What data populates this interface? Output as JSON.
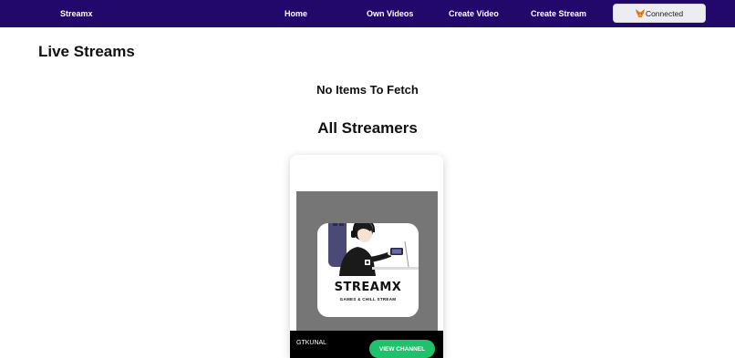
{
  "nav": {
    "brand": "Streamx",
    "links": [
      "Home",
      "Own Videos",
      "Create Video",
      "Create Stream"
    ],
    "wallet_label": "Connected",
    "wallet_icon": "metamask-fox-icon"
  },
  "live": {
    "title": "Live Streams",
    "empty_message": "No Items To Fetch"
  },
  "streamers": {
    "title": "All Streamers",
    "cards": [
      {
        "image_title": "STREAMX",
        "image_subtitle": "GAMES & CHILL STREAM",
        "owner": "GTKUNAL",
        "button_label": "VIEW CHANNEL"
      }
    ]
  },
  "colors": {
    "nav_bg": "#23086b",
    "button_green": "#1fc16b",
    "thumb_gray": "#767676"
  }
}
